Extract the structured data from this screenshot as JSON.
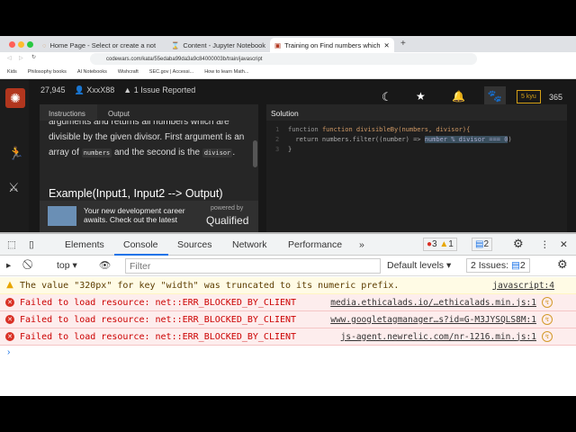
{
  "browser": {
    "tabs": [
      {
        "label": "Home Page - Select or create a not"
      },
      {
        "label": "Content - Jupyter Notebook"
      },
      {
        "label": "Training on Find numbers which"
      }
    ],
    "url": "codewars.com/kata/55edaba99da3a9c84000003b/train/javascript",
    "bookmarks": [
      "Kids",
      "Philosophy books",
      "AI Notebooks",
      "Wishcraft",
      "SEC.gov | Accessi...",
      "How to learn Math..."
    ]
  },
  "codewars": {
    "stats": {
      "count": "27,945",
      "author": "XxxX88",
      "issues": "1 Issue Reported"
    },
    "rank": "5 kyu",
    "honor": "365",
    "tabs": {
      "instructions": "Instructions",
      "output": "Output",
      "solution": "Solution"
    },
    "instructions": {
      "line1": "arguments and returns all numbers which are",
      "line2": "divisible by the given divisor. First argument is an",
      "pre1": "array of",
      "code1": "numbers",
      "mid": "and the second is the",
      "code2": "divisor",
      "end": ".",
      "example": "Example(Input1, Input2 --> Output)"
    },
    "ad": {
      "text1": "Your new development career",
      "text2": "awaits. Check out the latest",
      "powered": "powered by",
      "brand": "Qualified"
    },
    "code": [
      "function divisibleBy(numbers, divisor){",
      "  return numbers.filter((number) => ",
      "number % divisor === 0",
      ")",
      "}"
    ]
  },
  "devtools": {
    "tabs": [
      "Elements",
      "Console",
      "Sources",
      "Network",
      "Performance"
    ],
    "errors": "3",
    "warnings": "1",
    "issues_badge": "2",
    "context": "top",
    "filter_placeholder": "Filter",
    "levels": "Default levels",
    "issues_label": "2 Issues:",
    "issues_count": "2",
    "messages": [
      {
        "type": "warning",
        "text": "The value \"320px\" for key \"width\" was truncated to its numeric prefix.",
        "source": "javascript:4"
      },
      {
        "type": "error",
        "text": "Failed to load resource: net::ERR_BLOCKED_BY_CLIENT",
        "source": "media.ethicalads.io/…ethicalads.min.js:1"
      },
      {
        "type": "error",
        "text": "Failed to load resource: net::ERR_BLOCKED_BY_CLIENT",
        "source": "www.googletagmanager…s?id=G-M3JYSQLS8M:1"
      },
      {
        "type": "error",
        "text": "Failed to load resource: net::ERR_BLOCKED_BY_CLIENT",
        "source": "js-agent.newrelic.com/nr-1216.min.js:1"
      }
    ]
  }
}
